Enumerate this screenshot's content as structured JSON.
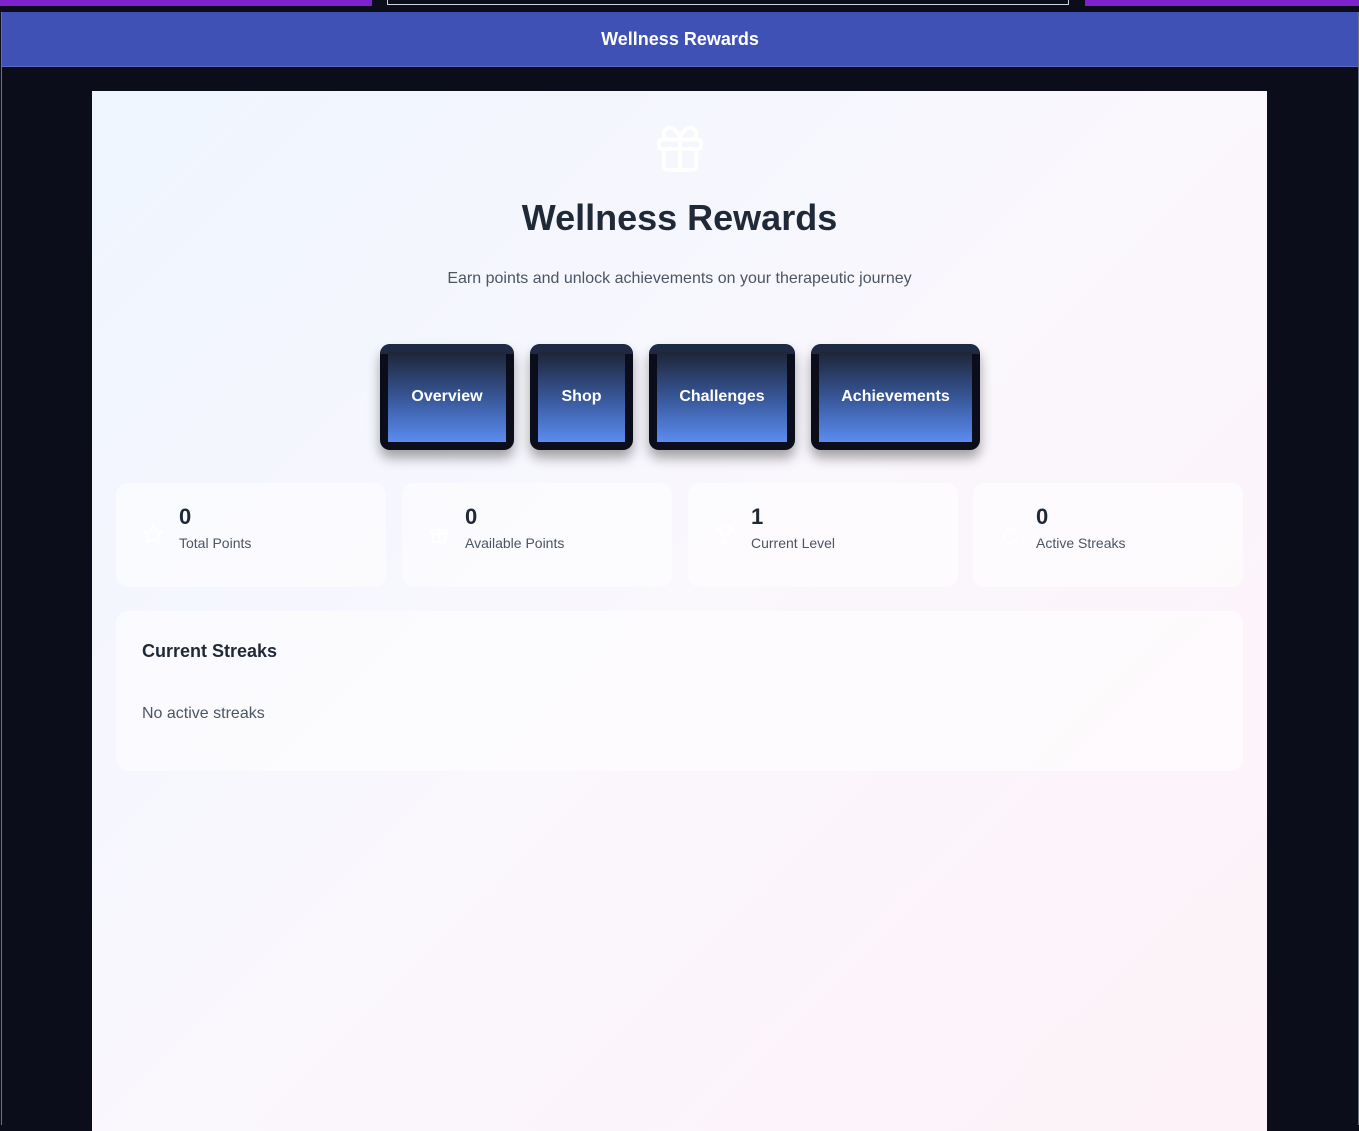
{
  "window": {
    "title": "Wellness Rewards"
  },
  "hero": {
    "icon": "gift-icon",
    "title": "Wellness Rewards",
    "subtitle": "Earn points and unlock achievements on your therapeutic journey"
  },
  "tabs": [
    {
      "label": "Overview"
    },
    {
      "label": "Shop"
    },
    {
      "label": "Challenges"
    },
    {
      "label": "Achievements"
    }
  ],
  "stats": [
    {
      "icon": "star-icon",
      "value": "0",
      "label": "Total Points"
    },
    {
      "icon": "gift-icon",
      "value": "0",
      "label": "Available Points"
    },
    {
      "icon": "trophy-icon",
      "value": "1",
      "label": "Current Level"
    },
    {
      "icon": "flame-icon",
      "value": "0",
      "label": "Active Streaks"
    }
  ],
  "streaks": {
    "title": "Current Streaks",
    "empty_message": "No active streaks"
  },
  "colors": {
    "titlebar": "#3f51b5",
    "accent_bar": "#7e22ce",
    "tab_gradient_end": "#5b8cf0",
    "text_dark": "#1f2937",
    "text_muted": "#4b5563"
  }
}
